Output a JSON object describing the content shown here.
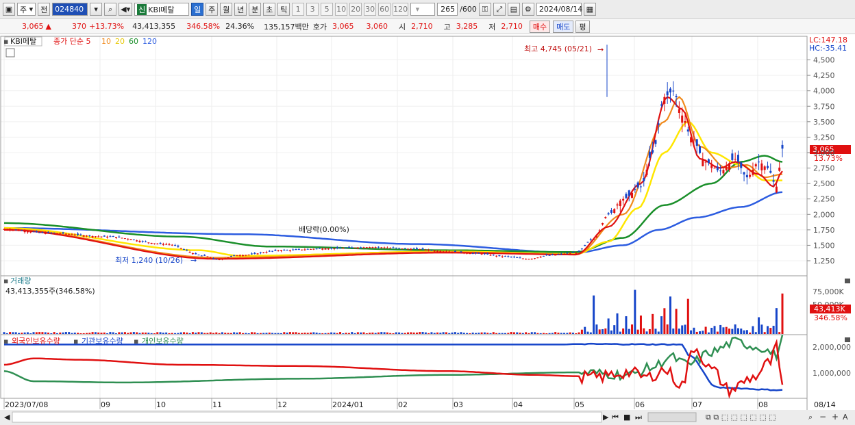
{
  "toolbar": {
    "jong": "주",
    "jeon": "전",
    "code": "024840",
    "shin": "신",
    "name": "KBI메탈",
    "periods": [
      "일",
      "주",
      "월",
      "년",
      "분",
      "초",
      "틱"
    ],
    "active_period": "일",
    "minutes": [
      "1",
      "3",
      "5",
      "10",
      "20",
      "30",
      "60",
      "120"
    ],
    "count": "265",
    "max": "/600",
    "date": "2024/08/14"
  },
  "quote": {
    "price": "3,065",
    "arrow": "▲",
    "change": "370",
    "change_pct": "+13.73%",
    "volume": "43,413,355",
    "volume_ratio": "346.58%",
    "turnover": "24.36%",
    "amount": "135,157백만",
    "ask_label": "호가",
    "ask": "3,065",
    "bid": "3,060",
    "open_label": "시",
    "open": "2,710",
    "high_label": "고",
    "high": "3,285",
    "low_label": "저",
    "low": "2,710",
    "buy": "매수",
    "sell": "매도",
    "eval": "평"
  },
  "price_panel": {
    "name": "KBI메탈",
    "legend_prefix": "종가 단순 5",
    "ma_labels": [
      "10",
      "20",
      "60",
      "120"
    ],
    "ma_colors": {
      "5": "#e01010",
      "10": "#f08a1c",
      "20": "#ffe600",
      "60": "#1a8f2a",
      "120": "#2c5ce0"
    },
    "lc": "LC:147.18",
    "hc": "HC:-35.41",
    "high_note": "최고 4,745 (05/21)",
    "low_note": "최저 1,240 (10/26)",
    "dividend_note": "배당락(0.00%)",
    "current_price": "3,065",
    "current_pct": "13.73%",
    "y_ticks": [
      "4,500",
      "4,250",
      "4,000",
      "3,750",
      "3,500",
      "3,250",
      "3,000",
      "2,750",
      "2,500",
      "2,250",
      "2,000",
      "1,750",
      "1,500",
      "1,250"
    ]
  },
  "volume_panel": {
    "title": "거래량",
    "value": "43,413,355주(346.58%)",
    "y_ticks": [
      "75,000K",
      "50,000K"
    ],
    "current": "43,413K",
    "current_pct": "346.58%"
  },
  "holding_panel": {
    "labels": [
      "외국인보유수량",
      "기관보유수량",
      "개인보유수량"
    ],
    "colors": [
      "#e01010",
      "#1645c9",
      "#2f8f52"
    ],
    "y_ticks": [
      "2,000,000",
      "1,000,000"
    ]
  },
  "x_axis": [
    "2023/07/08",
    "09",
    "10",
    "11",
    "12",
    "2024/01",
    "02",
    "03",
    "04",
    "05",
    "06",
    "07",
    "08",
    "08/14"
  ],
  "chart_data": {
    "type": "line",
    "series": [
      {
        "name": "종가",
        "x": [
          "2023/07",
          "2023/08",
          "2023/09",
          "2023/10",
          "2023/11",
          "2023/12",
          "2024/01",
          "2024/02",
          "2024/03",
          "2024/04",
          "2024/05",
          "2024/06",
          "2024/07",
          "2024/08/14"
        ],
        "values": [
          1750,
          1680,
          1560,
          1300,
          1420,
          1460,
          1500,
          1380,
          1290,
          1400,
          3900,
          2800,
          2800,
          3065
        ]
      },
      {
        "name": "120",
        "x": [
          "2023/07",
          "2023/10",
          "2024/01",
          "2024/04",
          "2024/05",
          "2024/06",
          "2024/07",
          "2024/08/14"
        ],
        "values": [
          1780,
          1700,
          1520,
          1380,
          1560,
          1900,
          2110,
          2360
        ]
      }
    ],
    "price_high": 4745,
    "price_low": 1240
  }
}
